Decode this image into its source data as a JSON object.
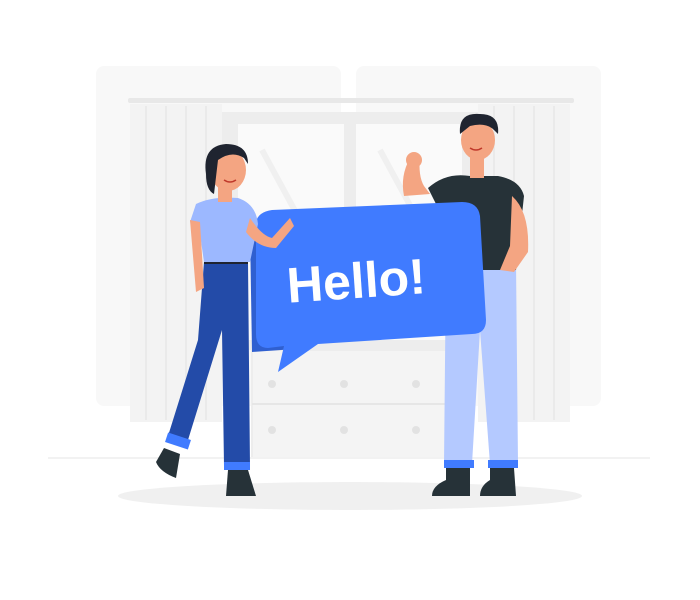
{
  "bubble": {
    "text": "Hello!"
  },
  "colors": {
    "accent": "#407BFF",
    "accent_dark": "#2F5FD0",
    "jeans": "#234BA8",
    "light_blue": "#9CB8FF",
    "pants_light": "#B4C9FF",
    "skin": "#F4A582",
    "hair": "#1F2430",
    "shirt_dark": "#263238",
    "background_gray": "#F2F2F2",
    "floor_shadow": "#F0F0F0"
  },
  "icons": {
    "background": "room-window-icon",
    "woman": "woman-figure-icon",
    "man": "man-figure-icon",
    "bubble": "speech-bubble-icon"
  }
}
